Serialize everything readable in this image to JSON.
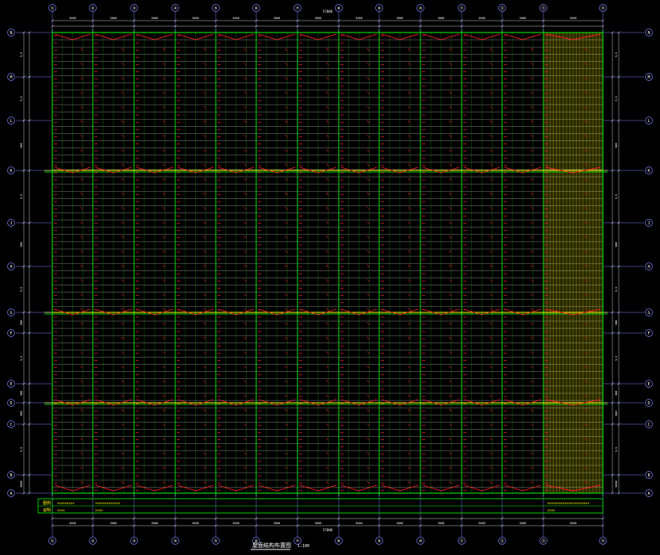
{
  "colors": {
    "background": "#000000",
    "grid_axis": "#8080ff",
    "purlin": "#ffffff",
    "beam": "#00ff00",
    "brace": "#ff2020",
    "highlight": "#ffff00",
    "dimension": "#ffffff"
  },
  "column_axes": [
    "①",
    "②",
    "③",
    "④",
    "⑤",
    "⑥",
    "⑦",
    "⑧",
    "⑨",
    "⑩",
    "⑪",
    "⑫",
    "⑬",
    "⑭"
  ],
  "row_axes": [
    "A",
    "B",
    "C",
    "D",
    "E",
    "F",
    "G",
    "H",
    "J",
    "K",
    "L",
    "M",
    "N"
  ],
  "top_overall_dimension": "57000",
  "bottom_overall_dimension": "57000",
  "top_bay_dimensions": [
    "5000",
    "5000",
    "5000",
    "5000",
    "5000",
    "5000",
    "5000",
    "5000",
    "5000",
    "5000",
    "5000",
    "5000",
    "5000",
    "5000"
  ],
  "bottom_bay_dimensions": [
    "5000",
    "5000",
    "5000",
    "5000",
    "5000",
    "5000",
    "5000",
    "5000",
    "5000",
    "5000",
    "5000",
    "5000",
    "5000",
    "5000"
  ],
  "left_dimensions": [
    "5000",
    "5,5",
    "500",
    "500",
    "5,5",
    "500",
    "5,5",
    "500",
    "5,5",
    "500",
    "5,5",
    "5,5"
  ],
  "right_dimensions": [
    "5000",
    "5,5",
    "500",
    "500",
    "5,5",
    "500",
    "5,5",
    "500",
    "5,5",
    "500",
    "5,5",
    "5,5"
  ],
  "legend": {
    "row1_label": "图例",
    "row1_note": "xxxxxxxxx",
    "row1_detail": "xxxxxxxxxxxxx",
    "row1_right": "xxxxxxxxxxxxxxxxxxxxxx",
    "row2_label": "说明",
    "row2_note": "xxxx",
    "row2_detail": "xxxx",
    "row2_right": "xxxx"
  },
  "drawing_title": "屋面结构布置图",
  "drawing_scale": "1:100"
}
